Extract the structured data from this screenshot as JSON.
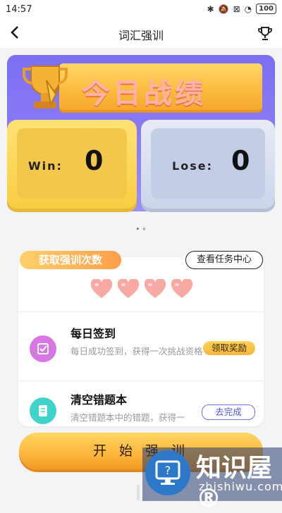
{
  "status_bar": {
    "time": "14:57",
    "battery": "100",
    "icons": [
      "bluetooth-icon",
      "mute-icon",
      "alarm-icon",
      "wifi-icon"
    ]
  },
  "nav": {
    "title": "词汇强训",
    "back_icon": "chevron-left-icon",
    "trophy_icon": "trophy-icon"
  },
  "record": {
    "title": "今日战绩",
    "win_label": "Win:",
    "win_value": "0",
    "lose_label": "Lose:",
    "lose_value": "0"
  },
  "pager": {
    "dots": "• ∘"
  },
  "tasks": {
    "tab_label": "获取强训次数",
    "center_button": "查看任务中心",
    "hearts_count": 4,
    "items": [
      {
        "name": "每日签到",
        "desc": "每日成功签到，获得一次挑战资格",
        "action": "领取奖励"
      },
      {
        "name": "清空错题本",
        "desc": "清空错题本中的错题，获得一",
        "action": "去完成"
      }
    ]
  },
  "start_button": "开 始 强 训",
  "watermark": {
    "title": "知识屋®",
    "subtitle": "zhishiwu.com"
  },
  "colors": {
    "accent_orange": "#fbb83a",
    "purple": "#7d6ff2",
    "win_yellow": "#f8cd41",
    "lose_blue": "#ccd4ea"
  }
}
